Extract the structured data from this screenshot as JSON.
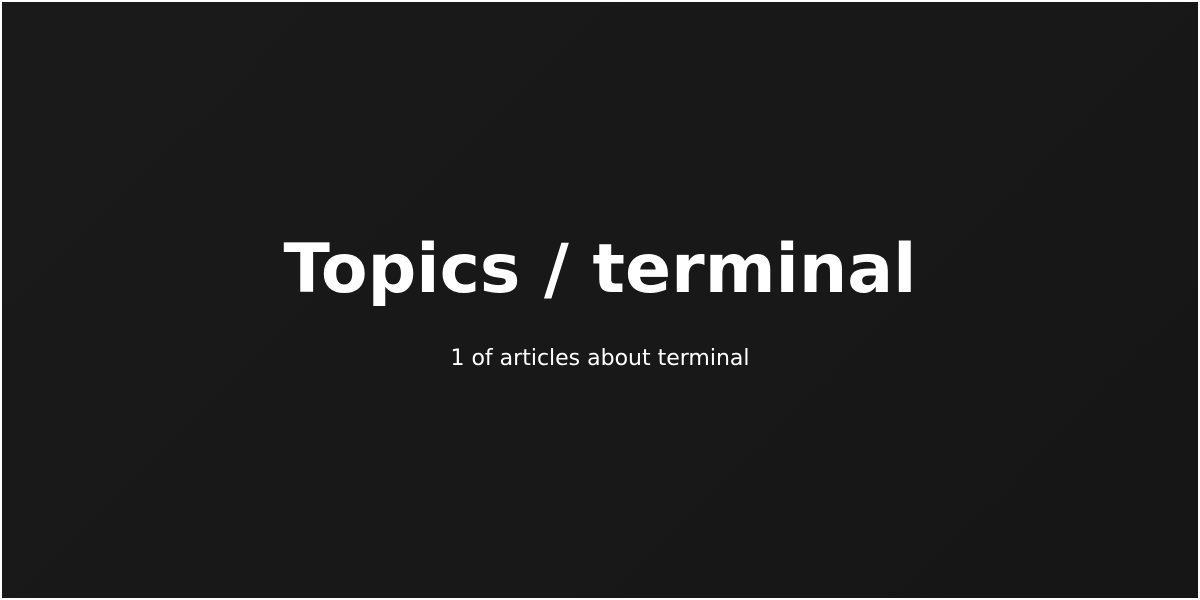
{
  "heading": {
    "title": "Topics / terminal",
    "subtitle": "1 of articles about terminal"
  },
  "colors": {
    "background": "#161616",
    "text": "#ffffff"
  }
}
